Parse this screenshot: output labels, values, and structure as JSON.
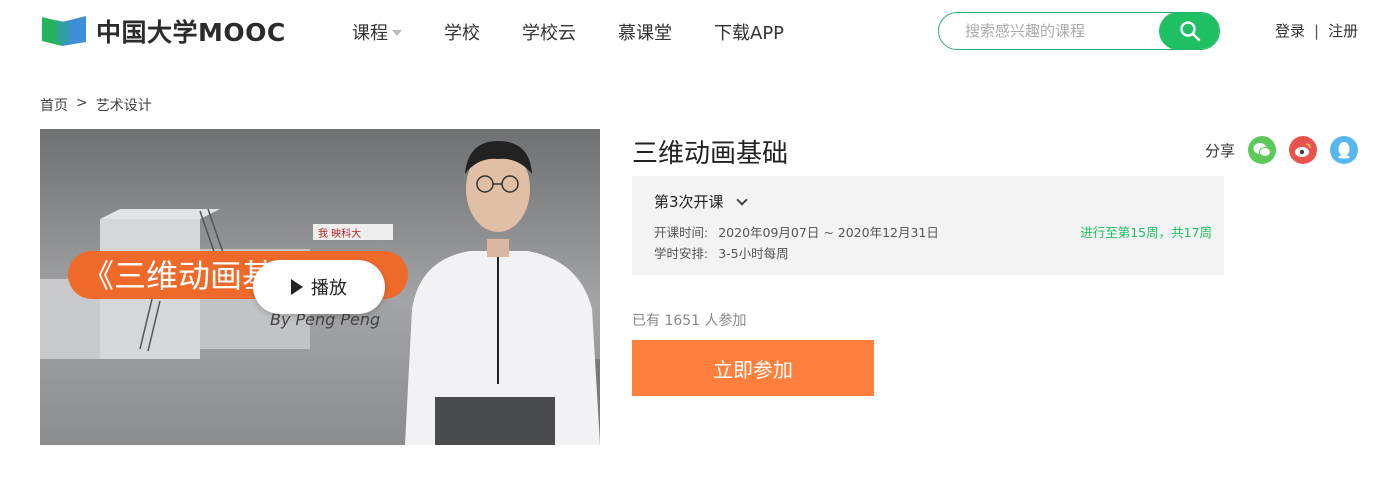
{
  "header": {
    "logo_text": "中国大学MOOC",
    "nav": [
      {
        "label": "课程",
        "has_dropdown": true
      },
      {
        "label": "学校"
      },
      {
        "label": "学校云"
      },
      {
        "label": "慕课堂"
      },
      {
        "label": "下载APP"
      }
    ],
    "search": {
      "placeholder": "搜索感兴趣的课程",
      "value": "",
      "icon": "search-icon"
    },
    "auth": {
      "login": "登录",
      "separator": "|",
      "register": "注册"
    }
  },
  "breadcrumb": {
    "home": "首页",
    "separator": ">",
    "category": "艺术设计"
  },
  "video": {
    "play_label": "播放",
    "overlay_title": "《三维动画基础》",
    "overlay_author": "By Peng Peng",
    "badge_text": "我 映科大"
  },
  "course": {
    "title": "三维动画基础",
    "share_label": "分享",
    "share_icons": [
      "wechat-icon",
      "weibo-icon",
      "qq-icon"
    ],
    "term": {
      "label": "第3次开课",
      "time_label": "开课时间:",
      "time_value": "2020年09月07日 ~ 2020年12月31日",
      "hours_label": "学时安排:",
      "hours_value": "3-5小时每周",
      "progress_text": "进行至第15周，共17周"
    },
    "enroll_text": "已有 1651 人参加",
    "join_label": "立即参加"
  },
  "colors": {
    "brand_green": "#1fbf64",
    "join_orange": "#ff7f3d",
    "wechat": "#5cc95a",
    "weibo": "#e8534d",
    "qq": "#56b6ee"
  }
}
